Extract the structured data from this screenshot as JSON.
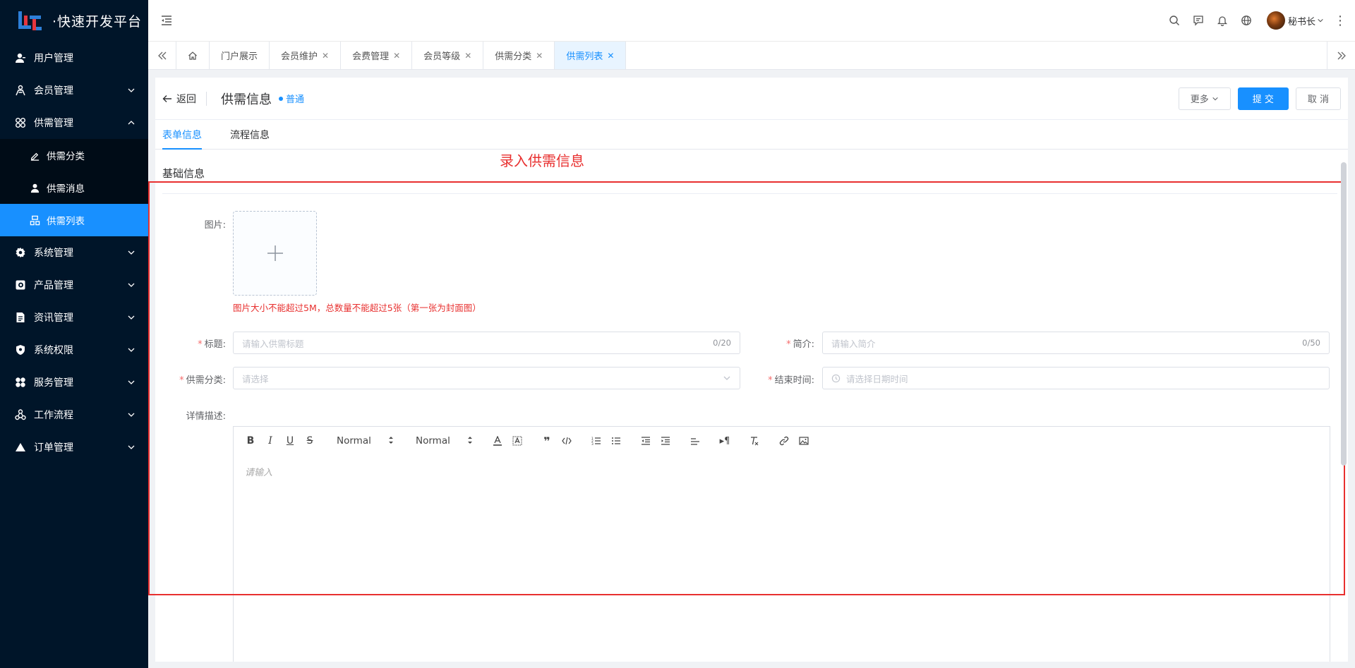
{
  "app": {
    "logo_text": "·快速开发平台"
  },
  "sidebar": {
    "items": [
      {
        "label": "用户管理",
        "icon": "user-icon",
        "expandable": false
      },
      {
        "label": "会员管理",
        "icon": "members-icon",
        "expandable": true
      },
      {
        "label": "供需管理",
        "icon": "supply-icon",
        "expandable": true,
        "expanded": true
      }
    ],
    "subitems": [
      {
        "label": "供需分类",
        "icon": "edit-icon",
        "active": false
      },
      {
        "label": "供需消息",
        "icon": "user-icon",
        "active": false
      },
      {
        "label": "供需列表",
        "icon": "list-icon",
        "active": true
      }
    ],
    "items_after": [
      {
        "label": "系统管理",
        "icon": "gear-icon"
      },
      {
        "label": "产品管理",
        "icon": "product-icon"
      },
      {
        "label": "资讯管理",
        "icon": "document-icon"
      },
      {
        "label": "系统权限",
        "icon": "shield-icon"
      },
      {
        "label": "服务管理",
        "icon": "service-icon"
      },
      {
        "label": "工作流程",
        "icon": "workflow-icon"
      },
      {
        "label": "订单管理",
        "icon": "triangle-icon"
      }
    ]
  },
  "header": {
    "user_name": "秘书长"
  },
  "tabs": [
    {
      "label": "门户展示",
      "closable": false
    },
    {
      "label": "会员维护",
      "closable": true
    },
    {
      "label": "会费管理",
      "closable": true
    },
    {
      "label": "会员等级",
      "closable": true
    },
    {
      "label": "供需分类",
      "closable": true
    },
    {
      "label": "供需列表",
      "closable": true,
      "active": true
    }
  ],
  "page": {
    "back_label": "返回",
    "title": "供需信息",
    "level_tag": "普通",
    "more_label": "更多",
    "submit_label": "提 交",
    "cancel_label": "取 消"
  },
  "form_tabs": [
    {
      "label": "表单信息",
      "active": true
    },
    {
      "label": "流程信息",
      "active": false
    }
  ],
  "annotation": "录入供需信息",
  "form": {
    "section_title": "基础信息",
    "image_label": "图片:",
    "image_tip": "图片大小不能超过5M，总数量不能超过5张（第一张为封面图）",
    "title_label": "标题:",
    "title_placeholder": "请输入供需标题",
    "title_counter": "0/20",
    "summary_label": "简介:",
    "summary_placeholder": "请输入简介",
    "summary_counter": "0/50",
    "category_label": "供需分类:",
    "category_placeholder": "请选择",
    "endtime_label": "结束时间:",
    "endtime_placeholder": "请选择日期时间",
    "detail_label": "详情描述:",
    "editor_font_size": "Normal",
    "editor_header": "Normal",
    "editor_placeholder": "请输入"
  },
  "colors": {
    "accent": "#1890ff",
    "sidebar_bg": "#001529",
    "annotation": "#e8302f"
  }
}
